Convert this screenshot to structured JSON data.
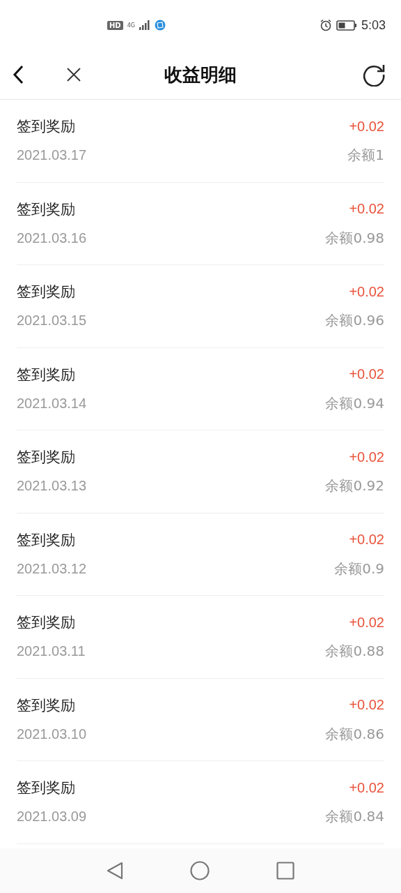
{
  "status_bar": {
    "hd": "HD",
    "network": "4G",
    "time": "5:03"
  },
  "header": {
    "title": "收益明细"
  },
  "records": [
    {
      "title": "签到奖励",
      "date": "2021.03.17",
      "amount": "+0.02",
      "balance": "余额1"
    },
    {
      "title": "签到奖励",
      "date": "2021.03.16",
      "amount": "+0.02",
      "balance": "余额0.98"
    },
    {
      "title": "签到奖励",
      "date": "2021.03.15",
      "amount": "+0.02",
      "balance": "余额0.96"
    },
    {
      "title": "签到奖励",
      "date": "2021.03.14",
      "amount": "+0.02",
      "balance": "余额0.94"
    },
    {
      "title": "签到奖励",
      "date": "2021.03.13",
      "amount": "+0.02",
      "balance": "余额0.92"
    },
    {
      "title": "签到奖励",
      "date": "2021.03.12",
      "amount": "+0.02",
      "balance": "余额0.9"
    },
    {
      "title": "签到奖励",
      "date": "2021.03.11",
      "amount": "+0.02",
      "balance": "余额0.88"
    },
    {
      "title": "签到奖励",
      "date": "2021.03.10",
      "amount": "+0.02",
      "balance": "余额0.86"
    },
    {
      "title": "签到奖励",
      "date": "2021.03.09",
      "amount": "+0.02",
      "balance": "余额0.84"
    }
  ]
}
